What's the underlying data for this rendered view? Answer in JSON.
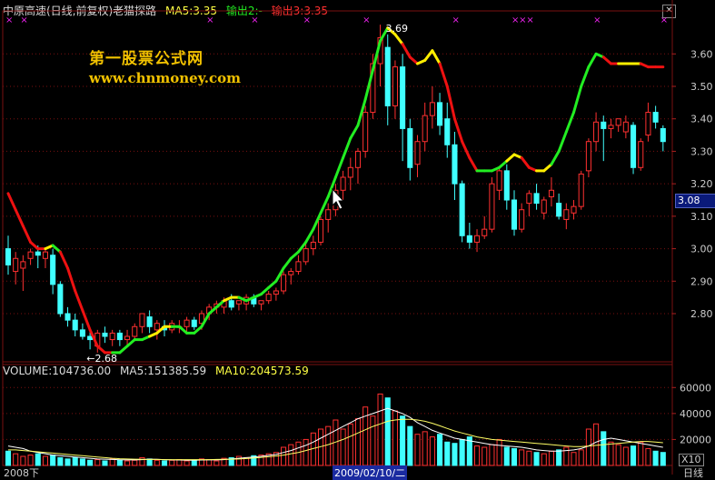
{
  "header": {
    "title": "中原高速(日线,前复权)老猫探路",
    "ma5": "MA5:3.35",
    "out2": "输出2:-",
    "out3": "输出3:3.35"
  },
  "watermark": {
    "line1": "第一股票公式网",
    "line2": "www.chnmoney.com"
  },
  "volume_header": {
    "volume": "VOLUME:104736.00",
    "ma5": "MA5:151385.59",
    "ma10": "MA10:204573.59"
  },
  "current_price": "3.08",
  "peak_label": "3.69",
  "low_label": "←2.68",
  "vol_scale": "X10",
  "bottom_labels": {
    "left": "2008下",
    "mid": "2009/02/10/二",
    "right": "日线"
  },
  "colors": {
    "up": "#ff3030",
    "down": "#40ffff",
    "green": "#22ee22",
    "red": "#ee1111",
    "yellow": "#ffee00",
    "magenta": "#ee22ee",
    "ma5": "#ffffff",
    "ma10": "#ffff66",
    "grid": "#7a1010"
  },
  "chart_data": [
    {
      "type": "candlestick",
      "title": "中原高速(日线,前复权)老猫探路",
      "ylim": [
        2.66,
        3.71
      ],
      "yticks": [
        "2.80",
        "2.90",
        "3.00",
        "3.10",
        "3.20",
        "3.30",
        "3.40",
        "3.50",
        "3.60"
      ],
      "x": [
        0,
        1,
        2,
        3,
        4,
        5,
        6,
        7,
        8,
        9,
        10,
        11,
        12,
        13,
        14,
        15,
        16,
        17,
        18,
        19,
        20,
        21,
        22,
        23,
        24,
        25,
        26,
        27,
        28,
        29,
        30,
        31,
        32,
        33,
        34,
        35,
        36,
        37,
        38,
        39,
        40,
        41,
        42,
        43,
        44,
        45,
        46,
        47,
        48,
        49,
        50,
        51,
        52,
        53,
        54,
        55,
        56,
        57,
        58,
        59,
        60,
        61,
        62,
        63,
        64,
        65,
        66,
        67,
        68,
        69,
        70,
        71,
        72,
        73,
        74,
        75,
        76,
        77,
        78,
        79,
        80,
        81,
        82,
        83,
        84,
        85,
        86,
        87,
        88
      ],
      "ohlc": [
        [
          3.0,
          3.04,
          2.92,
          2.95
        ],
        [
          2.93,
          2.99,
          2.89,
          2.97
        ],
        [
          2.94,
          2.98,
          2.87,
          2.96
        ],
        [
          2.97,
          3.0,
          2.95,
          2.99
        ],
        [
          2.99,
          3.01,
          2.94,
          2.98
        ],
        [
          2.97,
          3.0,
          2.94,
          2.99
        ],
        [
          2.98,
          3.0,
          2.86,
          2.89
        ],
        [
          2.89,
          2.9,
          2.79,
          2.8
        ],
        [
          2.8,
          2.82,
          2.76,
          2.78
        ],
        [
          2.78,
          2.8,
          2.73,
          2.75
        ],
        [
          2.75,
          2.77,
          2.72,
          2.73
        ],
        [
          2.73,
          2.75,
          2.69,
          2.72
        ],
        [
          2.7,
          2.75,
          2.68,
          2.74
        ],
        [
          2.74,
          2.76,
          2.71,
          2.73
        ],
        [
          2.72,
          2.75,
          2.7,
          2.74
        ],
        [
          2.74,
          2.75,
          2.7,
          2.72
        ],
        [
          2.72,
          2.75,
          2.7,
          2.73
        ],
        [
          2.73,
          2.77,
          2.72,
          2.76
        ],
        [
          2.76,
          2.8,
          2.74,
          2.8
        ],
        [
          2.79,
          2.81,
          2.74,
          2.76
        ],
        [
          2.75,
          2.78,
          2.72,
          2.77
        ],
        [
          2.76,
          2.78,
          2.73,
          2.75
        ],
        [
          2.75,
          2.78,
          2.74,
          2.77
        ],
        [
          2.76,
          2.78,
          2.74,
          2.76
        ],
        [
          2.76,
          2.79,
          2.74,
          2.78
        ],
        [
          2.78,
          2.79,
          2.75,
          2.76
        ],
        [
          2.77,
          2.81,
          2.75,
          2.8
        ],
        [
          2.8,
          2.83,
          2.78,
          2.82
        ],
        [
          2.82,
          2.84,
          2.8,
          2.83
        ],
        [
          2.82,
          2.85,
          2.8,
          2.84
        ],
        [
          2.84,
          2.86,
          2.81,
          2.82
        ],
        [
          2.83,
          2.84,
          2.81,
          2.84
        ],
        [
          2.83,
          2.86,
          2.81,
          2.85
        ],
        [
          2.85,
          2.86,
          2.82,
          2.83
        ],
        [
          2.83,
          2.84,
          2.81,
          2.84
        ],
        [
          2.84,
          2.87,
          2.83,
          2.86
        ],
        [
          2.86,
          2.88,
          2.84,
          2.87
        ],
        [
          2.87,
          2.93,
          2.86,
          2.92
        ],
        [
          2.92,
          2.94,
          2.89,
          2.93
        ],
        [
          2.93,
          2.98,
          2.92,
          2.96
        ],
        [
          2.96,
          3.02,
          2.95,
          3.0
        ],
        [
          3.0,
          3.04,
          2.98,
          3.02
        ],
        [
          3.02,
          3.1,
          3.01,
          3.09
        ],
        [
          3.09,
          3.14,
          3.05,
          3.12
        ],
        [
          3.12,
          3.2,
          3.1,
          3.18
        ],
        [
          3.18,
          3.24,
          3.15,
          3.22
        ],
        [
          3.22,
          3.28,
          3.18,
          3.25
        ],
        [
          3.25,
          3.31,
          3.2,
          3.3
        ],
        [
          3.3,
          3.44,
          3.28,
          3.42
        ],
        [
          3.42,
          3.6,
          3.4,
          3.57
        ],
        [
          3.57,
          3.69,
          3.5,
          3.65
        ],
        [
          3.62,
          3.66,
          3.38,
          3.44
        ],
        [
          3.44,
          3.58,
          3.4,
          3.56
        ],
        [
          3.56,
          3.6,
          3.27,
          3.37
        ],
        [
          3.37,
          3.4,
          3.21,
          3.25
        ],
        [
          3.26,
          3.35,
          3.22,
          3.33
        ],
        [
          3.33,
          3.45,
          3.3,
          3.41
        ],
        [
          3.41,
          3.5,
          3.37,
          3.45
        ],
        [
          3.45,
          3.48,
          3.35,
          3.38
        ],
        [
          3.4,
          3.45,
          3.28,
          3.32
        ],
        [
          3.32,
          3.36,
          3.15,
          3.2
        ],
        [
          3.2,
          3.21,
          3.02,
          3.04
        ],
        [
          3.04,
          3.08,
          3.0,
          3.02
        ],
        [
          3.02,
          3.06,
          2.99,
          3.04
        ],
        [
          3.04,
          3.1,
          3.03,
          3.06
        ],
        [
          3.06,
          3.22,
          3.05,
          3.2
        ],
        [
          3.18,
          3.25,
          3.15,
          3.24
        ],
        [
          3.24,
          3.26,
          3.12,
          3.15
        ],
        [
          3.15,
          3.18,
          3.04,
          3.06
        ],
        [
          3.06,
          3.14,
          3.05,
          3.12
        ],
        [
          3.14,
          3.18,
          3.1,
          3.17
        ],
        [
          3.17,
          3.2,
          3.12,
          3.14
        ],
        [
          3.11,
          3.16,
          3.09,
          3.15
        ],
        [
          3.16,
          3.22,
          3.13,
          3.18
        ],
        [
          3.14,
          3.17,
          3.09,
          3.1
        ],
        [
          3.09,
          3.14,
          3.06,
          3.12
        ],
        [
          3.11,
          3.15,
          3.09,
          3.13
        ],
        [
          3.13,
          3.24,
          3.12,
          3.23
        ],
        [
          3.24,
          3.34,
          3.22,
          3.33
        ],
        [
          3.33,
          3.42,
          3.3,
          3.39
        ],
        [
          3.39,
          3.41,
          3.27,
          3.37
        ],
        [
          3.37,
          3.4,
          3.34,
          3.38
        ],
        [
          3.38,
          3.4,
          3.36,
          3.4
        ],
        [
          3.36,
          3.41,
          3.34,
          3.39
        ],
        [
          3.38,
          3.39,
          3.23,
          3.25
        ],
        [
          3.25,
          3.34,
          3.24,
          3.33
        ],
        [
          3.35,
          3.45,
          3.33,
          3.42
        ],
        [
          3.42,
          3.44,
          3.37,
          3.39
        ],
        [
          3.37,
          3.38,
          3.3,
          3.33
        ]
      ],
      "signal_line": [
        3.17,
        3.12,
        3.07,
        3.02,
        3.0,
        3.0,
        3.01,
        2.99,
        2.94,
        2.87,
        2.81,
        2.75,
        2.7,
        2.68,
        2.68,
        2.68,
        2.7,
        2.72,
        2.72,
        2.73,
        2.74,
        2.76,
        2.76,
        2.76,
        2.74,
        2.74,
        2.76,
        2.8,
        2.82,
        2.84,
        2.85,
        2.85,
        2.84,
        2.85,
        2.86,
        2.88,
        2.9,
        2.94,
        2.97,
        2.99,
        3.02,
        3.06,
        3.11,
        3.16,
        3.22,
        3.28,
        3.34,
        3.38,
        3.46,
        3.55,
        3.64,
        3.68,
        3.66,
        3.63,
        3.59,
        3.57,
        3.58,
        3.61,
        3.57,
        3.5,
        3.4,
        3.33,
        3.28,
        3.24,
        3.24,
        3.24,
        3.25,
        3.27,
        3.29,
        3.28,
        3.25,
        3.24,
        3.24,
        3.26,
        3.3,
        3.36,
        3.42,
        3.5,
        3.56,
        3.6,
        3.59,
        3.57,
        3.57,
        3.57,
        3.57,
        3.57,
        3.56,
        3.56,
        3.56
      ],
      "signal_colors": [
        "r",
        "r",
        "r",
        "r",
        "r",
        "y",
        "g",
        "r",
        "r",
        "r",
        "r",
        "r",
        "r",
        "r",
        "g",
        "g",
        "g",
        "g",
        "g",
        "y",
        "y",
        "y",
        "g",
        "g",
        "g",
        "g",
        "g",
        "g",
        "g",
        "y",
        "y",
        "g",
        "g",
        "g",
        "g",
        "g",
        "g",
        "g",
        "g",
        "g",
        "g",
        "g",
        "g",
        "g",
        "g",
        "g",
        "g",
        "g",
        "g",
        "g",
        "g",
        "y",
        "y",
        "r",
        "r",
        "y",
        "y",
        "y",
        "r",
        "r",
        "r",
        "r",
        "r",
        "g",
        "g",
        "g",
        "g",
        "y",
        "y",
        "r",
        "r",
        "y",
        "y",
        "g",
        "g",
        "g",
        "g",
        "g",
        "g",
        "g",
        "r",
        "r",
        "y",
        "y",
        "y",
        "r",
        "r",
        "r",
        "r"
      ],
      "signal_markers_x": [
        0,
        2,
        27,
        33,
        40,
        48,
        60,
        68,
        69,
        70,
        79,
        88
      ]
    },
    {
      "type": "bar",
      "title": "VOLUME",
      "ylim": [
        0,
        70000
      ],
      "yticks": [
        "20000",
        "40000",
        "60000"
      ],
      "values": [
        11000,
        9000,
        7000,
        8000,
        9000,
        7000,
        8000,
        6000,
        5000,
        6000,
        5000,
        4000,
        4500,
        3500,
        5000,
        4000,
        3500,
        4000,
        6000,
        5000,
        4000,
        3500,
        4000,
        4500,
        3500,
        4000,
        5000,
        4500,
        3500,
        5500,
        6000,
        7000,
        6000,
        7500,
        8000,
        9000,
        10000,
        14000,
        16000,
        18000,
        20000,
        25000,
        28000,
        30000,
        35000,
        28000,
        32000,
        36000,
        45000,
        38000,
        55000,
        52000,
        42000,
        38000,
        30000,
        24000,
        26000,
        22000,
        24000,
        18000,
        17000,
        20000,
        22000,
        15000,
        14000,
        16000,
        20000,
        14000,
        13000,
        12000,
        11000,
        10000,
        9000,
        11000,
        12000,
        14000,
        10000,
        12000,
        28000,
        32000,
        26000,
        18000,
        16000,
        14000,
        15000,
        18000,
        13000,
        11000,
        10000
      ],
      "ma5": [
        15000,
        14000,
        13000,
        11000,
        10000,
        9000,
        8000,
        7500,
        7000,
        6500,
        6000,
        5500,
        5000,
        4800,
        4600,
        4400,
        4300,
        4300,
        4500,
        4800,
        4700,
        4500,
        4300,
        4200,
        4000,
        4000,
        4200,
        4300,
        4300,
        4500,
        5000,
        5500,
        6000,
        6500,
        7000,
        7800,
        8500,
        10000,
        11500,
        13500,
        15500,
        18000,
        21000,
        24000,
        27000,
        30000,
        33000,
        36000,
        38000,
        40000,
        42000,
        44000,
        42000,
        40000,
        37000,
        33000,
        30000,
        27000,
        25000,
        23000,
        21000,
        20000,
        19000,
        18000,
        17000,
        16000,
        15500,
        15000,
        14500,
        14000,
        13000,
        12000,
        11500,
        11000,
        11000,
        11500,
        12000,
        13000,
        15000,
        18000,
        20000,
        21000,
        20000,
        19000,
        18000,
        17000,
        16000,
        15000,
        14000
      ],
      "ma10": [
        12000,
        12000,
        11500,
        11000,
        10500,
        10000,
        9500,
        9000,
        8500,
        8000,
        7500,
        7000,
        6500,
        6000,
        5500,
        5200,
        5000,
        4800,
        4700,
        4600,
        4600,
        4500,
        4500,
        4500,
        4500,
        4500,
        4500,
        4500,
        4600,
        4700,
        4800,
        5000,
        5300,
        5700,
        6200,
        6700,
        7300,
        8000,
        9000,
        10000,
        11500,
        13000,
        14500,
        16000,
        18000,
        20000,
        22500,
        25000,
        27500,
        30000,
        32000,
        34000,
        35000,
        35500,
        35500,
        35000,
        34000,
        32500,
        30500,
        28500,
        26500,
        25000,
        23500,
        22000,
        21000,
        20000,
        19500,
        19000,
        18500,
        18000,
        17500,
        17000,
        16500,
        16000,
        15500,
        15000,
        14500,
        14500,
        15000,
        15500,
        16000,
        16500,
        17000,
        17500,
        18000,
        18500,
        18500,
        18000,
        17500
      ]
    }
  ]
}
